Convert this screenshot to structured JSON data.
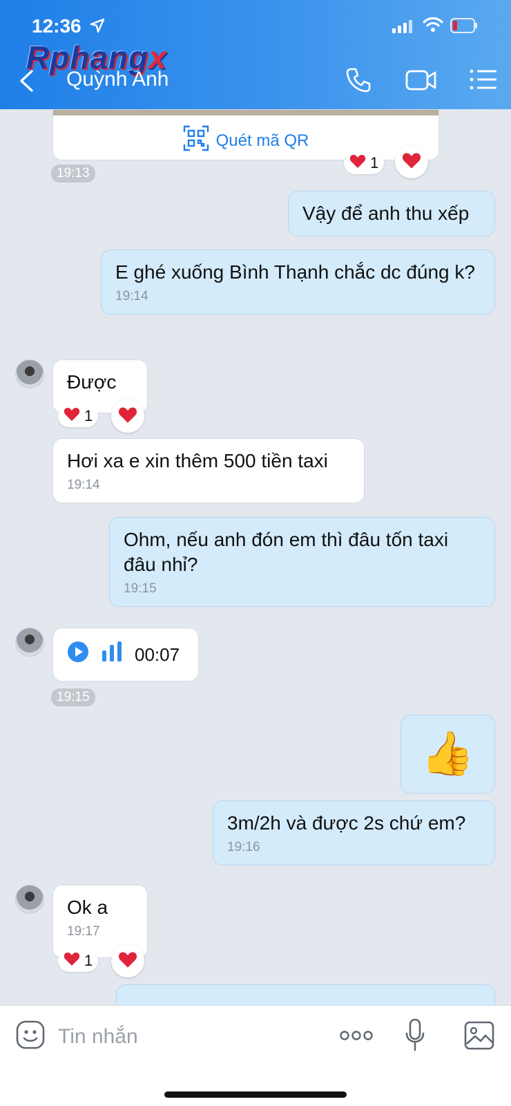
{
  "status": {
    "time": "12:36"
  },
  "header": {
    "watermark_main": "Rphang",
    "watermark_x": "x",
    "contact_name": "Quỳnh Anh"
  },
  "messages": {
    "qr_label": "Quét mã QR",
    "qr_reaction_count": "1",
    "time_1913": "19:13",
    "m1": "Vậy để anh thu xếp",
    "m2": "E ghé xuống Bình Thạnh chắc dc đúng k?",
    "m2_time": "19:14",
    "m3": "Được",
    "m3_reaction_count": "1",
    "m4": "Hơi xa e xin thêm 500 tiền taxi",
    "m4_time": "19:14",
    "m5": "Ohm, nếu anh đón em thì đâu tốn taxi đâu nhỉ?",
    "m5_time": "19:15",
    "voice_duration": "00:07",
    "voice_time": "19:15",
    "m6_emoji": "👍",
    "m7": "3m/2h và được 2s chứ em?",
    "m7_time": "19:16",
    "m8": "Ok a",
    "m8_time": "19:17",
    "m8_reaction_count": "1"
  },
  "input": {
    "placeholder": "Tin nhắn"
  },
  "colors": {
    "header_blue": "#1f7fe8",
    "outgoing_bubble": "#d4ebfb",
    "incoming_bubble": "#ffffff",
    "heart": "#e0243a"
  },
  "icons": [
    "location-arrow-icon",
    "signal-icon",
    "wifi-icon",
    "battery-icon",
    "back-chevron-icon",
    "phone-icon",
    "video-camera-icon",
    "list-menu-icon",
    "qr-code-icon",
    "heart-icon",
    "play-icon",
    "audio-bars-icon",
    "sticker-icon",
    "more-dots-icon",
    "microphone-icon",
    "gallery-icon"
  ]
}
